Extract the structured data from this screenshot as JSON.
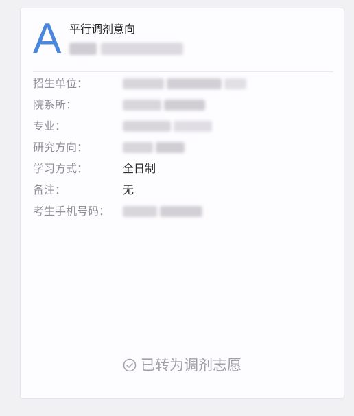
{
  "card": {
    "avatar_letter": "A",
    "title": "平行调剂意向",
    "subtitle_redacted": true,
    "fields": [
      {
        "label": "招生单位：",
        "value": null,
        "redacted": true
      },
      {
        "label": "院系所：",
        "value": null,
        "redacted": true
      },
      {
        "label": "专业：",
        "value": null,
        "redacted": true
      },
      {
        "label": "研究方向：",
        "value": null,
        "redacted": true
      },
      {
        "label": "学习方式：",
        "value": "全日制",
        "redacted": false
      },
      {
        "label": "备注：",
        "value": "无",
        "redacted": false
      },
      {
        "label": "考生手机号码：",
        "value": null,
        "redacted": true
      }
    ],
    "status_text": "已转为调剂志愿"
  },
  "colors": {
    "accent": "#4a88df",
    "label_gray": "#8e8e93",
    "status_gray": "#a0a0a6",
    "card_bg": "#fdfcfe",
    "page_bg": "#f1f1f3"
  },
  "icons": {
    "status": "check-circle-icon"
  }
}
